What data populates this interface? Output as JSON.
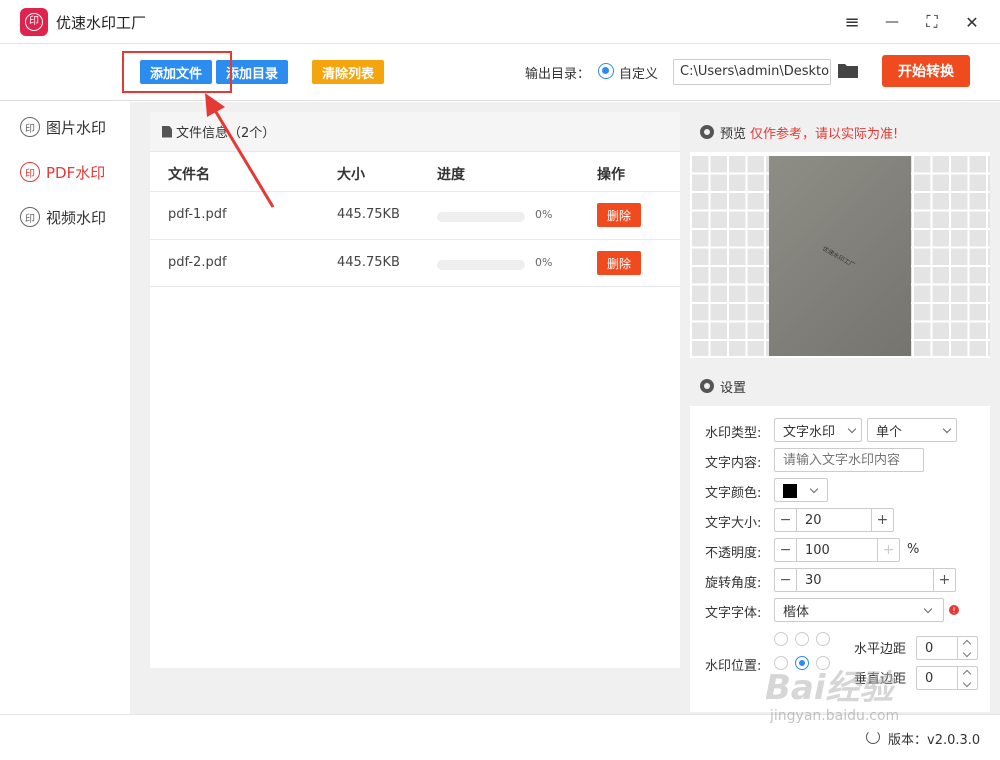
{
  "app": {
    "title": "优速水印工厂",
    "logo_text": "印"
  },
  "window_controls": {
    "menu": "≡",
    "minimize": "—",
    "maximize": "⛶",
    "close": "✕"
  },
  "toolbar": {
    "add_file": "添加文件",
    "add_dir": "添加目录",
    "clear_list": "清除列表",
    "output_label": "输出目录：",
    "custom_label": "自定义",
    "output_path": "C:\\Users\\admin\\Deskto",
    "start_label": "开始转换"
  },
  "sidebar": {
    "items": [
      {
        "icon": "印",
        "label": "图片水印",
        "active": false
      },
      {
        "icon": "印",
        "label": "PDF水印",
        "active": true
      },
      {
        "icon": "印",
        "label": "视频水印",
        "active": false
      }
    ]
  },
  "file_panel": {
    "title": "文件信息（2个）",
    "headers": {
      "name": "文件名",
      "size": "大小",
      "progress": "进度",
      "action": "操作"
    },
    "rows": [
      {
        "name": "pdf-1.pdf",
        "size": "445.75KB",
        "progress": "0%",
        "action": "删除"
      },
      {
        "name": "pdf-2.pdf",
        "size": "445.75KB",
        "progress": "0%",
        "action": "删除"
      }
    ]
  },
  "preview": {
    "title": "预览",
    "warning": "仅作参考，请以实际为准!",
    "watermark_text": "优速水印工厂"
  },
  "settings": {
    "title": "设置",
    "type_label": "水印类型:",
    "type_value": "文字水印",
    "mode_value": "单个",
    "content_label": "文字内容:",
    "content_placeholder": "请输入文字水印内容",
    "color_label": "文字颜色:",
    "color_value": "#000000",
    "size_label": "文字大小:",
    "size_value": "20",
    "opacity_label": "不透明度:",
    "opacity_value": "100",
    "opacity_unit": "%",
    "rotate_label": "旋转角度:",
    "rotate_value": "30",
    "font_label": "文字字体:",
    "font_value": "楷体",
    "position_label": "水印位置:",
    "h_margin_label": "水平边距",
    "h_margin_value": "0",
    "v_margin_label": "垂直边距",
    "v_margin_value": "0"
  },
  "status": {
    "version": "版本：v2.0.3.0"
  },
  "overlay": {
    "baidu": "Bai经验",
    "url": "jingyan.baidu.com"
  },
  "colors": {
    "accent_blue": "#2d8cf0",
    "accent_red": "#f04b1e",
    "active_red": "#e53935",
    "orange": "#f5a40c"
  }
}
